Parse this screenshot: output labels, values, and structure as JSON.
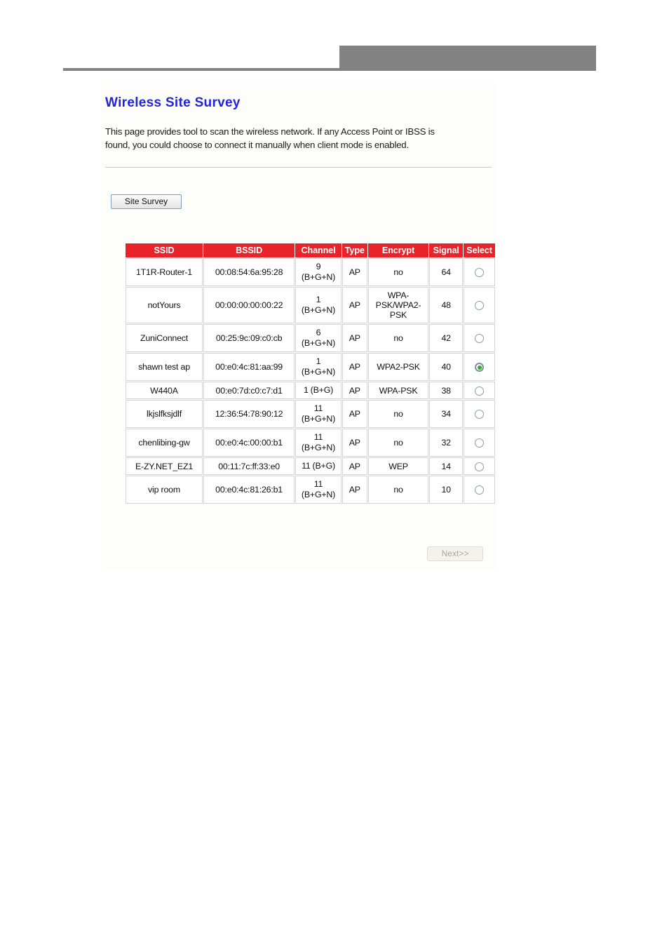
{
  "banner": {
    "block_color": "#828282",
    "rule_color": "#828282"
  },
  "page": {
    "title": "Wireless Site Survey",
    "description": "This page provides tool to scan the wireless network. If any Access Point or IBSS is found, you could choose to connect it manually when client mode is enabled.",
    "accent_title_color": "#2323d8",
    "table_header_color": "#e8242a"
  },
  "actions": {
    "site_survey_label": "Site Survey",
    "next_label": "Next>>",
    "next_disabled": true
  },
  "table": {
    "columns": [
      "SSID",
      "BSSID",
      "Channel",
      "Type",
      "Encrypt",
      "Signal",
      "Select"
    ],
    "rows": [
      {
        "ssid": "1T1R-Router-1",
        "bssid": "00:08:54:6a:95:28",
        "channel": "9",
        "band": "(B+G+N)",
        "type": "AP",
        "encrypt": "no",
        "signal": "64",
        "selected": false
      },
      {
        "ssid": "notYours",
        "bssid": "00:00:00:00:00:22",
        "channel": "1",
        "band": "(B+G+N)",
        "type": "AP",
        "encrypt": "WPA-PSK/WPA2-PSK",
        "signal": "48",
        "selected": false
      },
      {
        "ssid": "ZuniConnect",
        "bssid": "00:25:9c:09:c0:cb",
        "channel": "6",
        "band": "(B+G+N)",
        "type": "AP",
        "encrypt": "no",
        "signal": "42",
        "selected": false
      },
      {
        "ssid": "shawn test ap",
        "bssid": "00:e0:4c:81:aa:99",
        "channel": "1",
        "band": "(B+G+N)",
        "type": "AP",
        "encrypt": "WPA2-PSK",
        "signal": "40",
        "selected": true
      },
      {
        "ssid": "W440A",
        "bssid": "00:e0:7d:c0:c7:d1",
        "channel": "1",
        "band": "(B+G)",
        "type": "AP",
        "encrypt": "WPA-PSK",
        "signal": "38",
        "selected": false
      },
      {
        "ssid": "lkjslfksjdlf",
        "bssid": "12:36:54:78:90:12",
        "channel": "11",
        "band": "(B+G+N)",
        "type": "AP",
        "encrypt": "no",
        "signal": "34",
        "selected": false
      },
      {
        "ssid": "chenlibing-gw",
        "bssid": "00:e0:4c:00:00:b1",
        "channel": "11",
        "band": "(B+G+N)",
        "type": "AP",
        "encrypt": "no",
        "signal": "32",
        "selected": false
      },
      {
        "ssid": "E-ZY.NET_EZ1",
        "bssid": "00:11:7c:ff:33:e0",
        "channel": "11",
        "band": "(B+G)",
        "type": "AP",
        "encrypt": "WEP",
        "signal": "14",
        "selected": false
      },
      {
        "ssid": "vip room",
        "bssid": "00:e0:4c:81:26:b1",
        "channel": "11",
        "band": "(B+G+N)",
        "type": "AP",
        "encrypt": "no",
        "signal": "10",
        "selected": false
      }
    ]
  }
}
